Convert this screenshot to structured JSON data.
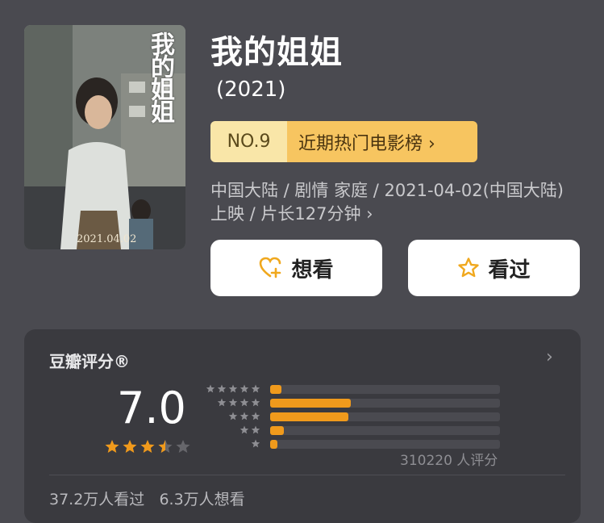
{
  "movie": {
    "title": "我的姐姐",
    "year": "(2021)",
    "poster": {
      "title_text": "我的姐姐",
      "date": "2021.04.02"
    },
    "meta": "中国大陆 / 剧情 家庭 / 2021-04-02(中国大陆) 上映 / 片长127分钟 ›"
  },
  "ranking": {
    "number": "NO.9",
    "list_label": "近期热门电影榜 ›"
  },
  "actions": {
    "want_label": "想看",
    "seen_label": "看过"
  },
  "rating": {
    "header": "豆瓣评分®",
    "chevron": "›",
    "score": "7.0",
    "stars": 3.5,
    "max_stars": 5,
    "distribution_percent": {
      "five": 5,
      "four": 35,
      "three": 34,
      "two": 6,
      "one": 3
    },
    "count_text": "310220 人评分",
    "watched_text": "37.2万人看过",
    "wish_text": "6.3万人想看"
  },
  "colors": {
    "background": "#4a4a50",
    "card": "#3a3a3f",
    "accent_orange": "#f09a1c",
    "rank_light": "#f9e6a8",
    "rank_dark": "#f7c560"
  }
}
